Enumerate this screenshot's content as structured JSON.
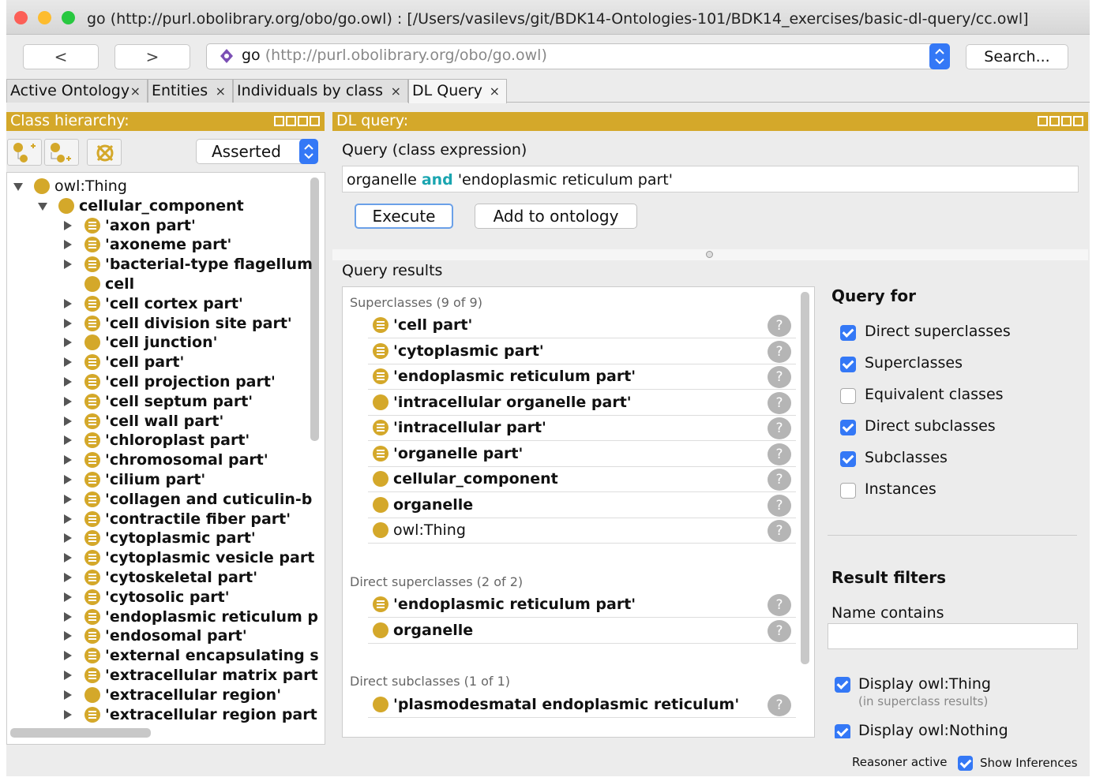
{
  "window": {
    "title": "go (http://purl.obolibrary.org/obo/go.owl)  : [/Users/vasilevs/git/BDK14-Ontologies-101/BDK14_exercises/basic-dl-query/cc.owl]"
  },
  "nav": {
    "back": "<",
    "forward": ">",
    "address_name": "go",
    "address_uri": "(http://purl.obolibrary.org/obo/go.owl)",
    "search_label": "Search..."
  },
  "tabs": [
    {
      "label": "Active Ontology",
      "close": "×"
    },
    {
      "label": "Entities",
      "close": "×"
    },
    {
      "label": "Individuals by class",
      "close": "×"
    },
    {
      "label": "DL Query",
      "close": "×"
    }
  ],
  "left_panel": {
    "title": "Class hierarchy:",
    "mode": "Asserted",
    "tree": [
      {
        "label": "owl:Thing",
        "level": 0,
        "arrow": "down",
        "icon": "plain",
        "bold": false
      },
      {
        "label": "cellular_component",
        "level": 1,
        "arrow": "down",
        "icon": "plain",
        "bold": true
      },
      {
        "label": "'axon part'",
        "level": 2,
        "arrow": "right",
        "icon": "defined",
        "bold": true
      },
      {
        "label": "'axoneme part'",
        "level": 2,
        "arrow": "right",
        "icon": "defined",
        "bold": true
      },
      {
        "label": "'bacterial-type flagellum",
        "level": 2,
        "arrow": "right",
        "icon": "defined",
        "bold": true
      },
      {
        "label": "cell",
        "level": 2,
        "arrow": "none",
        "icon": "plain",
        "bold": true
      },
      {
        "label": "'cell cortex part'",
        "level": 2,
        "arrow": "right",
        "icon": "defined",
        "bold": true
      },
      {
        "label": "'cell division site part'",
        "level": 2,
        "arrow": "right",
        "icon": "defined",
        "bold": true
      },
      {
        "label": "'cell junction'",
        "level": 2,
        "arrow": "right",
        "icon": "plain",
        "bold": true
      },
      {
        "label": "'cell part'",
        "level": 2,
        "arrow": "right",
        "icon": "defined",
        "bold": true
      },
      {
        "label": "'cell projection part'",
        "level": 2,
        "arrow": "right",
        "icon": "defined",
        "bold": true
      },
      {
        "label": "'cell septum part'",
        "level": 2,
        "arrow": "right",
        "icon": "defined",
        "bold": true
      },
      {
        "label": "'cell wall part'",
        "level": 2,
        "arrow": "right",
        "icon": "defined",
        "bold": true
      },
      {
        "label": "'chloroplast part'",
        "level": 2,
        "arrow": "right",
        "icon": "defined",
        "bold": true
      },
      {
        "label": "'chromosomal part'",
        "level": 2,
        "arrow": "right",
        "icon": "defined",
        "bold": true
      },
      {
        "label": "'cilium part'",
        "level": 2,
        "arrow": "right",
        "icon": "defined",
        "bold": true
      },
      {
        "label": "'collagen and cuticulin-b",
        "level": 2,
        "arrow": "right",
        "icon": "defined",
        "bold": true
      },
      {
        "label": "'contractile fiber part'",
        "level": 2,
        "arrow": "right",
        "icon": "defined",
        "bold": true
      },
      {
        "label": "'cytoplasmic part'",
        "level": 2,
        "arrow": "right",
        "icon": "defined",
        "bold": true
      },
      {
        "label": "'cytoplasmic vesicle part",
        "level": 2,
        "arrow": "right",
        "icon": "defined",
        "bold": true
      },
      {
        "label": "'cytoskeletal part'",
        "level": 2,
        "arrow": "right",
        "icon": "defined",
        "bold": true
      },
      {
        "label": "'cytosolic part'",
        "level": 2,
        "arrow": "right",
        "icon": "defined",
        "bold": true
      },
      {
        "label": "'endoplasmic reticulum p",
        "level": 2,
        "arrow": "right",
        "icon": "defined",
        "bold": true
      },
      {
        "label": "'endosomal part'",
        "level": 2,
        "arrow": "right",
        "icon": "defined",
        "bold": true
      },
      {
        "label": "'external encapsulating s",
        "level": 2,
        "arrow": "right",
        "icon": "defined",
        "bold": true
      },
      {
        "label": "'extracellular matrix part",
        "level": 2,
        "arrow": "right",
        "icon": "defined",
        "bold": true
      },
      {
        "label": "'extracellular region'",
        "level": 2,
        "arrow": "right",
        "icon": "plain",
        "bold": true
      },
      {
        "label": "'extracellular region part",
        "level": 2,
        "arrow": "right",
        "icon": "defined",
        "bold": true
      }
    ]
  },
  "right_panel": {
    "title": "DL query:",
    "query_label": "Query (class expression)",
    "query": {
      "before": "organelle ",
      "keyword": "and",
      "after": " 'endoplasmic reticulum part'"
    },
    "execute": "Execute",
    "add_to_ontology": "Add to ontology",
    "results_label": "Query results",
    "help": "?",
    "sections": [
      {
        "header": "Superclasses (9 of 9)",
        "items": [
          {
            "label": "'cell part'",
            "icon": "defined",
            "bold": true
          },
          {
            "label": "'cytoplasmic part'",
            "icon": "defined",
            "bold": true
          },
          {
            "label": "'endoplasmic reticulum part'",
            "icon": "defined",
            "bold": true
          },
          {
            "label": "'intracellular organelle part'",
            "icon": "plain",
            "bold": true
          },
          {
            "label": "'intracellular part'",
            "icon": "defined",
            "bold": true
          },
          {
            "label": "'organelle part'",
            "icon": "defined",
            "bold": true
          },
          {
            "label": "cellular_component",
            "icon": "plain",
            "bold": true
          },
          {
            "label": "organelle",
            "icon": "plain",
            "bold": true
          },
          {
            "label": "owl:Thing",
            "icon": "plain",
            "bold": false
          }
        ]
      },
      {
        "header": "Direct superclasses (2 of 2)",
        "items": [
          {
            "label": "'endoplasmic reticulum part'",
            "icon": "defined",
            "bold": true
          },
          {
            "label": "organelle",
            "icon": "plain",
            "bold": true
          }
        ]
      },
      {
        "header": "Direct subclasses (1 of 1)",
        "items": [
          {
            "label": "'plasmodesmatal endoplasmic reticulum'",
            "icon": "plain",
            "bold": true
          }
        ]
      }
    ],
    "query_for": {
      "title": "Query for",
      "options": [
        {
          "label": "Direct superclasses",
          "checked": true
        },
        {
          "label": "Superclasses",
          "checked": true
        },
        {
          "label": "Equivalent classes",
          "checked": false
        },
        {
          "label": "Direct subclasses",
          "checked": true
        },
        {
          "label": "Subclasses",
          "checked": true
        },
        {
          "label": "Instances",
          "checked": false
        }
      ]
    },
    "filters": {
      "title": "Result filters",
      "name_contains_label": "Name contains",
      "name_contains_value": "",
      "display_thing": "Display owl:Thing",
      "display_thing_note": "(in superclass results)",
      "display_nothing": "Display owl:Nothing"
    }
  },
  "status": {
    "reasoner": "Reasoner active",
    "show_inferences": "Show Inferences",
    "show_inferences_checked": true
  },
  "colors": {
    "accent": "#d4a82a",
    "checkbox": "#3478f6",
    "keyword": "#1aa5b0"
  }
}
